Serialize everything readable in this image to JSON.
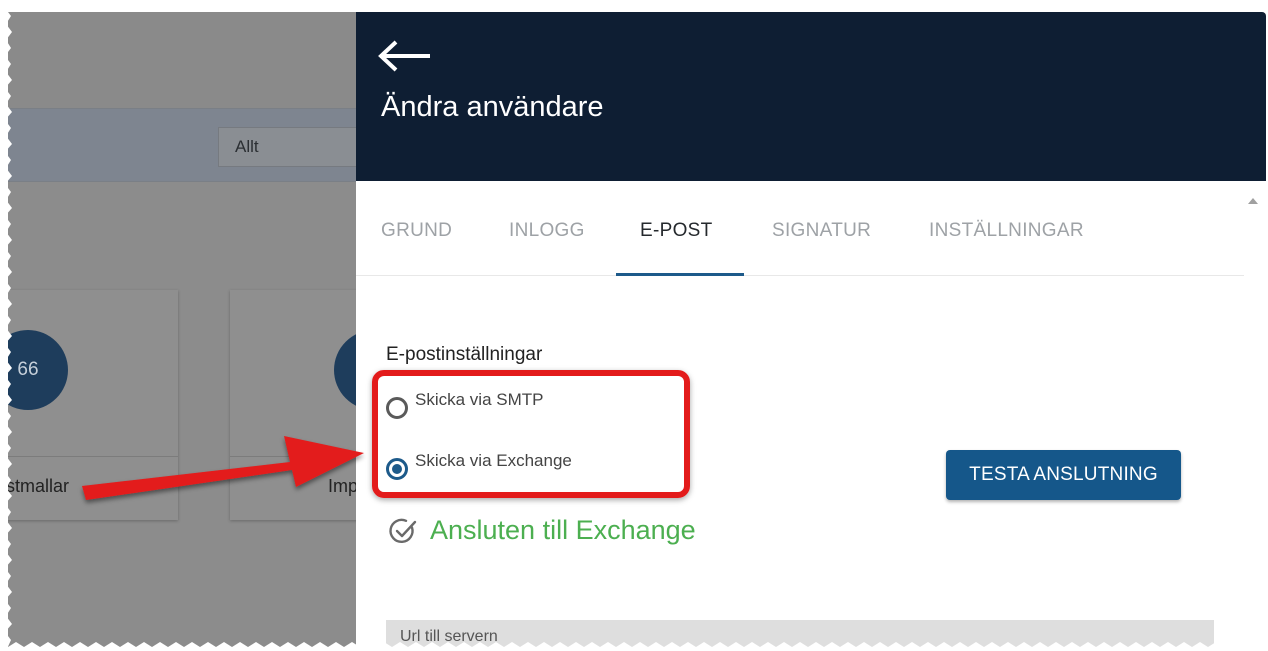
{
  "background": {
    "filter_value": "Allt",
    "card1": {
      "count": "66",
      "label": "stmallar"
    },
    "card2": {
      "label": "Imp"
    }
  },
  "panel": {
    "back_icon": "arrow-left-icon",
    "title": "Ändra användare",
    "tabs": [
      {
        "label": "GRUND",
        "active": false
      },
      {
        "label": "INLOGG",
        "active": false
      },
      {
        "label": "E-POST",
        "active": true
      },
      {
        "label": "SIGNATUR",
        "active": false
      },
      {
        "label": "INSTÄLLNINGAR",
        "active": false
      }
    ],
    "section_title": "E-postinställningar",
    "radio_options": [
      {
        "label": "Skicka via SMTP",
        "checked": false
      },
      {
        "label": "Skicka via Exchange",
        "checked": true
      }
    ],
    "test_button": "TESTA ANSLUTNING",
    "status_text": "Ansluten till Exchange",
    "url_label": "Url till servern"
  },
  "colors": {
    "header": "#0e1e33",
    "accent": "#1d5a8a",
    "success": "#4caf50",
    "annotation": "#e31b1b"
  }
}
